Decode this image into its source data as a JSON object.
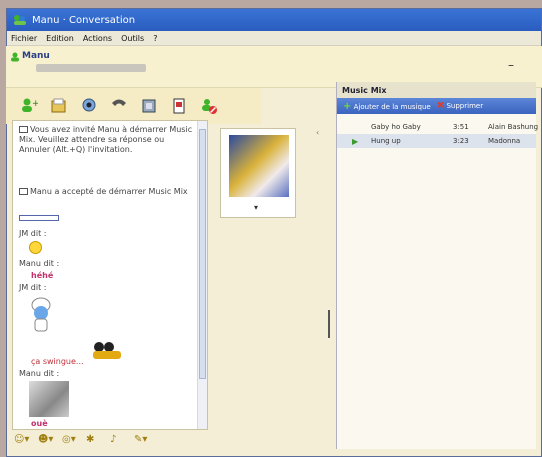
{
  "window": {
    "title": "Manu · Conversation"
  },
  "menu": {
    "items": [
      "Fichier",
      "Edition",
      "Actions",
      "Outils",
      "?"
    ]
  },
  "contact": {
    "name": "Manu"
  },
  "messages": {
    "invite": "Vous avez invité Manu à démarrer Music Mix. Veuillez attendre sa réponse ou Annuler (Alt.+Q) l'invitation.",
    "accepted": "Manu a accepté de démarrer Music Mix",
    "jm_said_1": "JM dit :",
    "manu_said_1": "Manu dit :",
    "hehe": "héhé",
    "jm_said_2": "JM dit :",
    "swing": "ça swingue...",
    "manu_said_2": "Manu dit :",
    "oue": "ouè"
  },
  "music": {
    "panel_title": "Music Mix",
    "add_label": "Ajouter de la musique",
    "remove_label": "Supprimer",
    "tracks": [
      {
        "title": "Gaby ho Gaby",
        "duration": "3:51",
        "artist": "Alain Bashung",
        "active": false
      },
      {
        "title": "Hung up",
        "duration": "3:23",
        "artist": "Madonna",
        "active": true
      }
    ]
  }
}
